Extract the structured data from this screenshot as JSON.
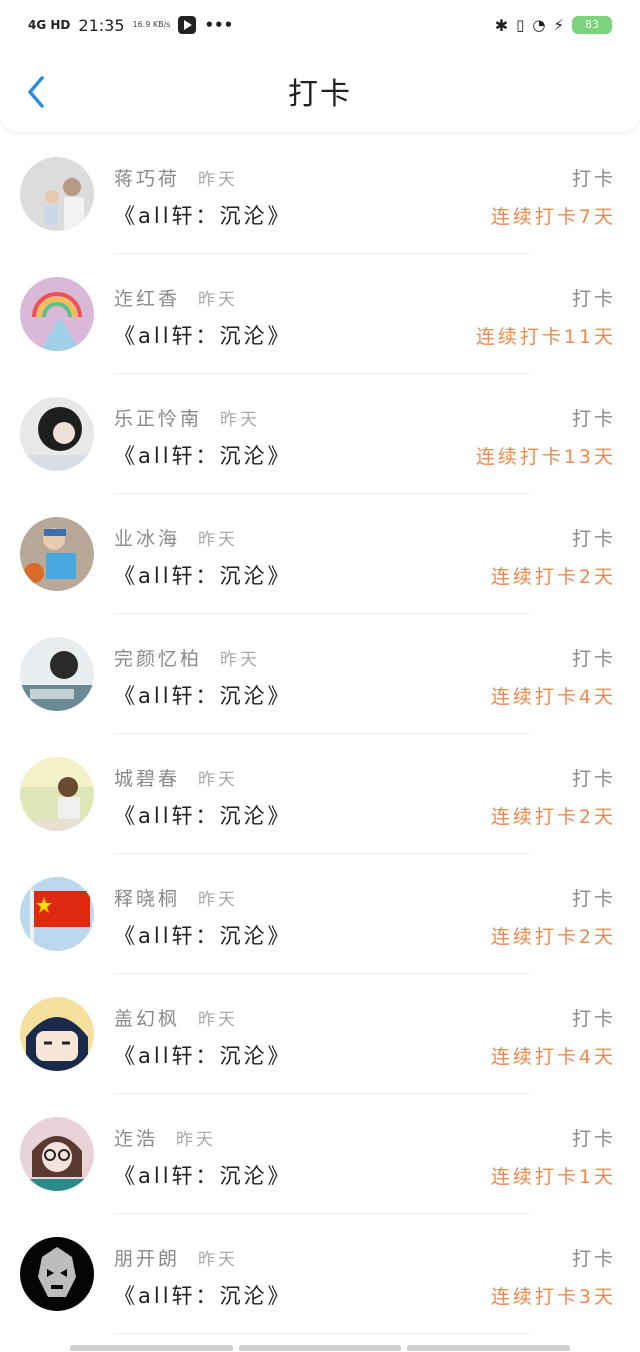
{
  "status_bar": {
    "network": "4G HD",
    "time": "21:35",
    "speed": "16.9 KB/s",
    "battery": "83"
  },
  "header": {
    "title": "打卡"
  },
  "rows": [
    {
      "name": "蒋巧荷",
      "time": "昨天",
      "book": "《all轩：沉沦》",
      "action": "打卡",
      "streak": "连续打卡7天"
    },
    {
      "name": "迮红香",
      "time": "昨天",
      "book": "《all轩：沉沦》",
      "action": "打卡",
      "streak": "连续打卡11天"
    },
    {
      "name": "乐正怜南",
      "time": "昨天",
      "book": "《all轩：沉沦》",
      "action": "打卡",
      "streak": "连续打卡13天"
    },
    {
      "name": "业冰海",
      "time": "昨天",
      "book": "《all轩：沉沦》",
      "action": "打卡",
      "streak": "连续打卡2天"
    },
    {
      "name": "完颜忆柏",
      "time": "昨天",
      "book": "《all轩：沉沦》",
      "action": "打卡",
      "streak": "连续打卡4天"
    },
    {
      "name": "城碧春",
      "time": "昨天",
      "book": "《all轩：沉沦》",
      "action": "打卡",
      "streak": "连续打卡2天"
    },
    {
      "name": "释晓桐",
      "time": "昨天",
      "book": "《all轩：沉沦》",
      "action": "打卡",
      "streak": "连续打卡2天"
    },
    {
      "name": "盖幻枫",
      "time": "昨天",
      "book": "《all轩：沉沦》",
      "action": "打卡",
      "streak": "连续打卡4天"
    },
    {
      "name": "迮浩",
      "time": "昨天",
      "book": "《all轩：沉沦》",
      "action": "打卡",
      "streak": "连续打卡1天"
    },
    {
      "name": "朋开朗",
      "time": "昨天",
      "book": "《all轩：沉沦》",
      "action": "打卡",
      "streak": "连续打卡3天"
    }
  ],
  "colors": {
    "accent_blue": "#2a8fe0",
    "streak_orange": "#ef8a4b"
  }
}
